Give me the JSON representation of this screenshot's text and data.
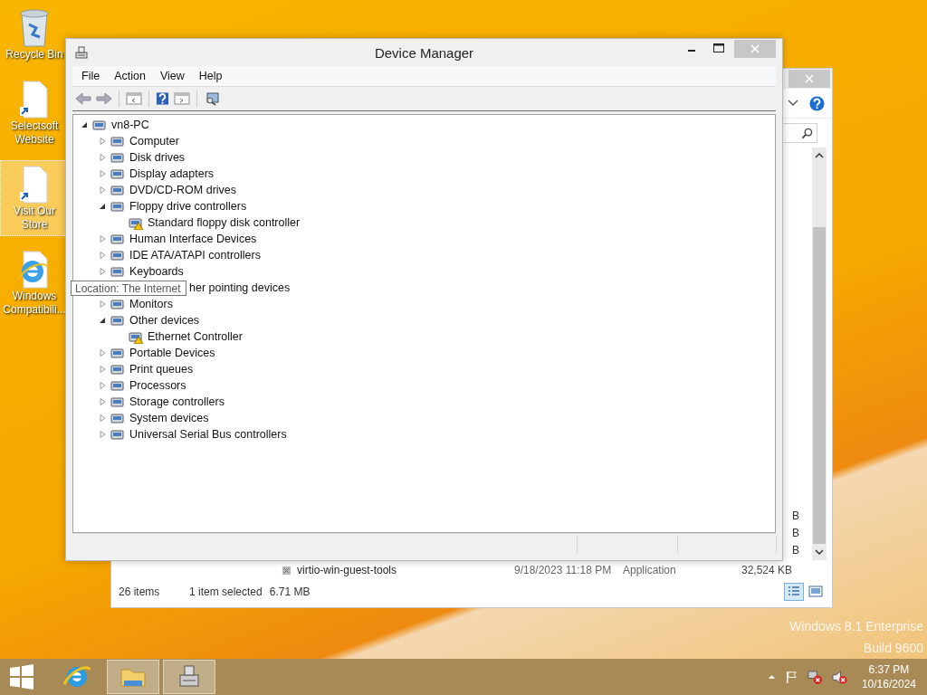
{
  "desktop_icons": [
    {
      "label": "Recycle Bin",
      "kind": "recycle",
      "selected": false
    },
    {
      "label": "Selectsoft Website",
      "kind": "shortcut",
      "selected": false
    },
    {
      "label": "Visit Our Store",
      "kind": "shortcut",
      "selected": true
    },
    {
      "label": "Windows Compatibili...",
      "kind": "browser",
      "selected": false
    }
  ],
  "explorer_window": {
    "size_fragments": [
      "B",
      "B",
      "B"
    ],
    "file_row": {
      "name": "virtio-win-guest-tools",
      "date": "9/18/2023 11:18 PM",
      "type": "Application",
      "size": "32,524 KB"
    },
    "status": {
      "count": "26 items",
      "selection": "1 item selected",
      "selection_size": "6.71 MB"
    }
  },
  "device_manager": {
    "title": "Device Manager",
    "menu": [
      "File",
      "Action",
      "View",
      "Help"
    ],
    "tree": {
      "label": "vn8-PC",
      "expanded": true,
      "children": [
        {
          "label": "Computer",
          "expanded": false
        },
        {
          "label": "Disk drives",
          "expanded": false
        },
        {
          "label": "Display adapters",
          "expanded": false
        },
        {
          "label": "DVD/CD-ROM drives",
          "expanded": false
        },
        {
          "label": "Floppy drive controllers",
          "expanded": true,
          "children": [
            {
              "label": "Standard floppy disk controller",
              "warning": true
            }
          ]
        },
        {
          "label": "Human Interface Devices",
          "expanded": false
        },
        {
          "label": "IDE ATA/ATAPI controllers",
          "expanded": false
        },
        {
          "label": "Keyboards",
          "expanded": false
        },
        {
          "label": "her pointing devices",
          "kind": "covered"
        },
        {
          "label": "Monitors",
          "expanded": false
        },
        {
          "label": "Other devices",
          "expanded": true,
          "children": [
            {
              "label": "Ethernet Controller",
              "warning": true
            }
          ]
        },
        {
          "label": "Portable Devices",
          "expanded": false
        },
        {
          "label": "Print queues",
          "expanded": false
        },
        {
          "label": "Processors",
          "expanded": false
        },
        {
          "label": "Storage controllers",
          "expanded": false
        },
        {
          "label": "System devices",
          "expanded": false
        },
        {
          "label": "Universal Serial Bus controllers",
          "expanded": false
        }
      ]
    }
  },
  "tooltip": "Location: The Internet",
  "watermark": [
    "Windows 8.1 Enterprise",
    "Build 9600"
  ],
  "taskbar": {
    "apps": [
      {
        "kind": "browser",
        "selected": false
      },
      {
        "kind": "folder",
        "selected": true
      },
      {
        "kind": "device",
        "selected": true
      }
    ],
    "time": "6:37 PM",
    "date": "10/16/2024"
  }
}
